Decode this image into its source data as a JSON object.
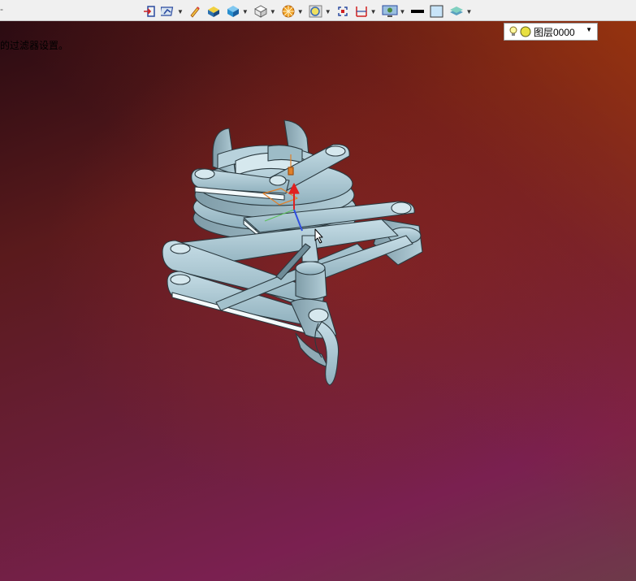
{
  "titlebar": {
    "marker": "-"
  },
  "viewport": {
    "hint_text": "的过滤器设置。",
    "background_colors": [
      "#2a0b12",
      "#7a2050",
      "#a33a10"
    ]
  },
  "toolbar": {
    "buttons": [
      {
        "name": "exit-icon",
        "has_dropdown": false
      },
      {
        "name": "view-orient-icon",
        "has_dropdown": true
      },
      {
        "name": "pen-icon",
        "has_dropdown": false
      },
      {
        "name": "shaded-box-icon",
        "has_dropdown": false
      },
      {
        "name": "blue-cube-icon",
        "has_dropdown": true
      },
      {
        "name": "white-cube-icon",
        "has_dropdown": true
      },
      {
        "name": "section-wheel-icon",
        "has_dropdown": true
      },
      {
        "name": "zoom-icon",
        "has_dropdown": true
      },
      {
        "name": "fit-icon",
        "has_dropdown": false
      },
      {
        "name": "dimension-icon",
        "has_dropdown": true
      },
      {
        "name": "display-icon",
        "has_dropdown": true
      },
      {
        "name": "black-rect-icon",
        "has_dropdown": false
      },
      {
        "name": "light-blue-square-icon",
        "has_dropdown": false
      },
      {
        "name": "layers-icon",
        "has_dropdown": true
      }
    ],
    "layer_select": {
      "value": "图层0000"
    }
  },
  "model": {
    "part_color": "#a9c6d2",
    "edge_color": "#2b3a40",
    "axis_colors": {
      "x": "#e0802a",
      "y": "#5cc05c",
      "z": "#e02020",
      "w": "#3050e0"
    }
  }
}
